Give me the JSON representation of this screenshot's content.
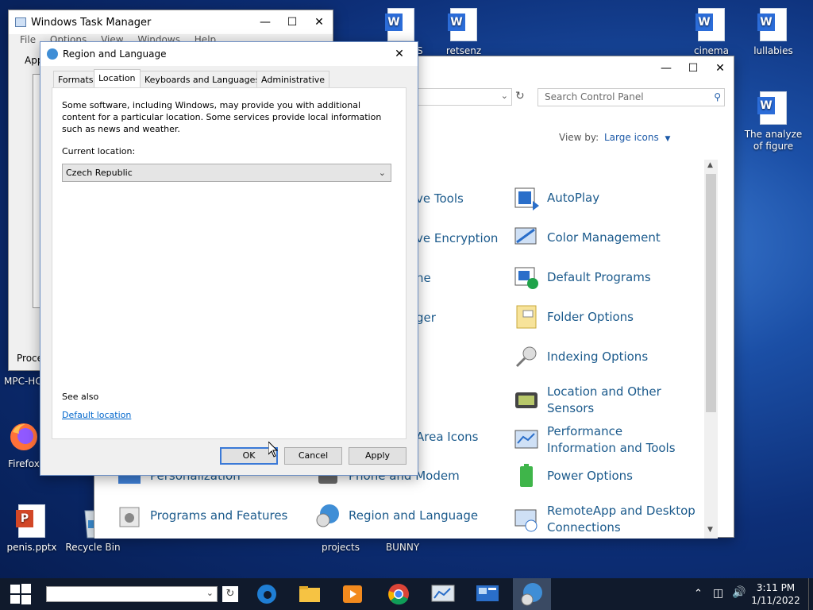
{
  "desktop": {
    "icons": [
      {
        "label": "ES"
      },
      {
        "label": "retsenz"
      },
      {
        "label": "cinema"
      },
      {
        "label": "lullabies"
      },
      {
        "label": "The analyze of figure"
      },
      {
        "label": "MPC-HC"
      },
      {
        "label": "Firefox"
      },
      {
        "label": "penis.pptx"
      },
      {
        "label": "Recycle Bin"
      },
      {
        "label": "projects"
      },
      {
        "label": "BUNNY"
      }
    ]
  },
  "task_manager": {
    "title": "Windows Task Manager",
    "menu": [
      "File",
      "Options",
      "View",
      "Windows",
      "Help"
    ],
    "tab_fragment": "App",
    "status_fragment": "Proce"
  },
  "control_panel": {
    "search_placeholder": "Search Control Panel",
    "view_by_label": "View by:",
    "view_by_value": "Large icons",
    "items_col1": [
      "Personalization",
      "Programs and Features"
    ],
    "items_col2": [
      "ve Tools",
      "ve Encryption",
      "ne",
      "ger",
      "Area Icons",
      "Phone and Modem",
      "Region and Language"
    ],
    "items_col3": [
      "AutoPlay",
      "Color Management",
      "Default Programs",
      "Folder Options",
      "Indexing Options",
      "Location and Other Sensors",
      "Performance Information and Tools",
      "Power Options",
      "RemoteApp and Desktop Connections"
    ]
  },
  "dialog": {
    "title": "Region and Language",
    "tabs": [
      "Formats",
      "Location",
      "Keyboards and Languages",
      "Administrative"
    ],
    "description": "Some software, including Windows, may provide you with additional content for a particular location. Some services provide local information such as news and weather.",
    "current_location_label": "Current location:",
    "current_location_value": "Czech Republic",
    "see_also_label": "See also",
    "default_location_link": "Default location",
    "buttons": {
      "ok": "OK",
      "cancel": "Cancel",
      "apply": "Apply"
    }
  },
  "taskbar": {
    "clock_time": "3:11 PM",
    "clock_date": "1/11/2022"
  },
  "colors": {
    "accent": "#3a79d7",
    "link": "#0066cc",
    "cp_link": "#1b5a8c"
  }
}
